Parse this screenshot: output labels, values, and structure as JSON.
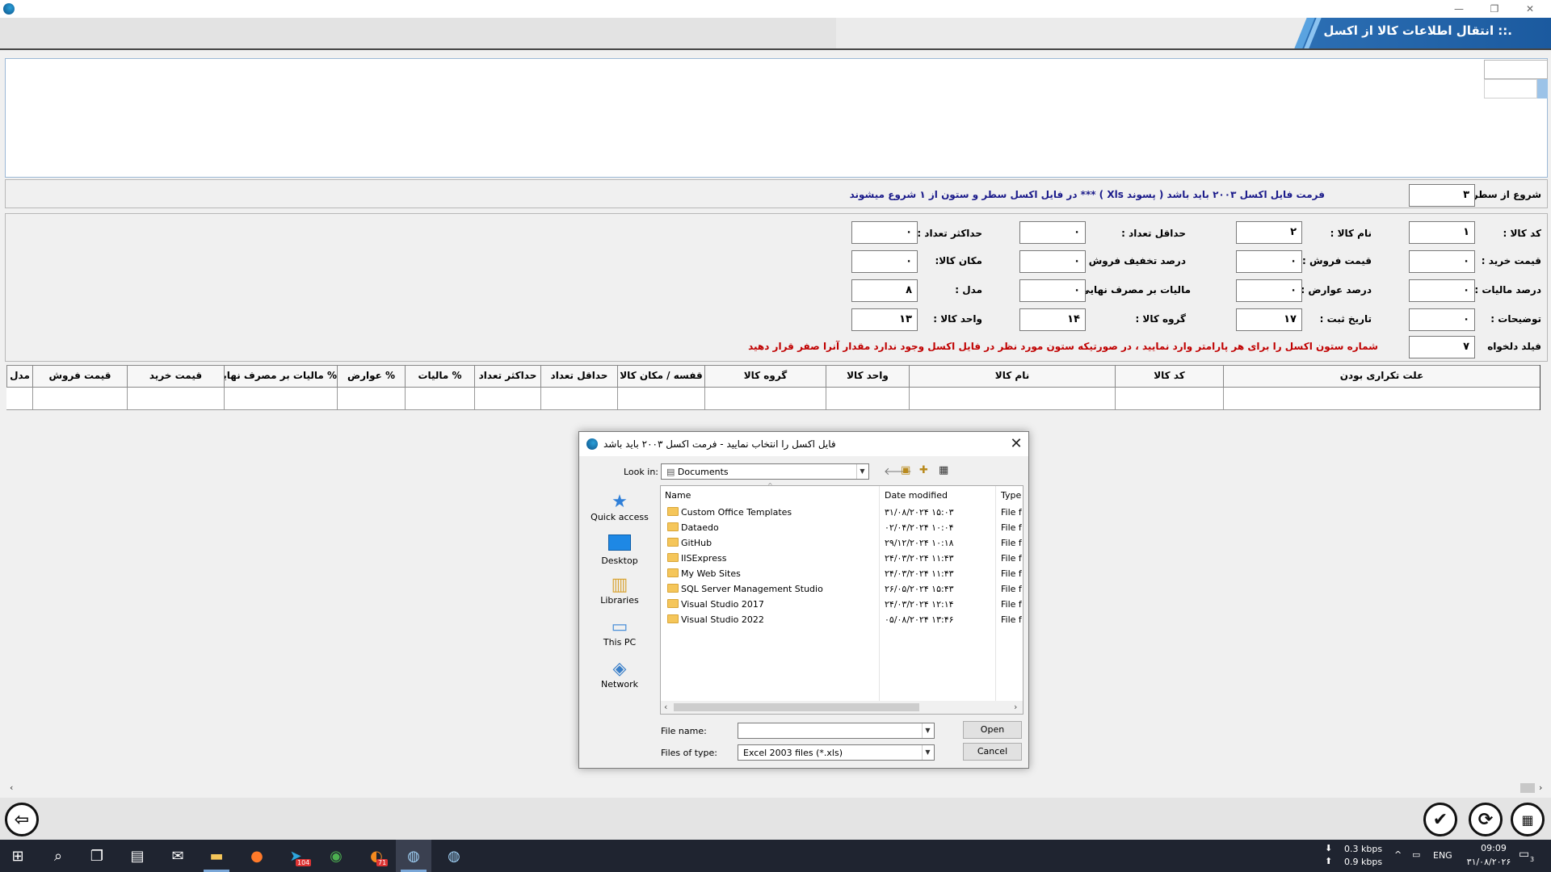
{
  "window": {
    "title": ".:: انتقال اطلاعات کالا از اکسل",
    "controls": {
      "minimize": "—",
      "restore": "❐",
      "close": "✕"
    }
  },
  "start_row": {
    "label": "شروع از سطر :",
    "value": "۳",
    "note": "فرمت فایل اکسل ۲۰۰۳ باید باشد ( پسوند Xls ) ***  در فایل اکسل سطر و ستون از ۱ شروع میشوند"
  },
  "fields": [
    {
      "key": "code",
      "label": "کد کالا :",
      "value": "۱"
    },
    {
      "key": "name",
      "label": "نام کالا :",
      "value": "۲"
    },
    {
      "key": "min_qty",
      "label": "حداقل تعداد :",
      "value": "۰"
    },
    {
      "key": "max_qty",
      "label": "حداکثر تعداد :",
      "value": "۰"
    },
    {
      "key": "buy_price",
      "label": "قیمت خرید :",
      "value": "۰"
    },
    {
      "key": "sell_price",
      "label": "قیمت فروش :",
      "value": "۰"
    },
    {
      "key": "sell_discount",
      "label": "درصد تخفیف فروش :",
      "value": "۰"
    },
    {
      "key": "location",
      "label": "مکان کالا:",
      "value": "۰"
    },
    {
      "key": "tax_percent",
      "label": "درصد مالیات :",
      "value": "۰"
    },
    {
      "key": "duty_percent",
      "label": "درصد عوارض :",
      "value": "۰"
    },
    {
      "key": "consumer_tax",
      "label": "مالیات بر مصرف نهایی :",
      "value": "۰"
    },
    {
      "key": "model",
      "label": "مدل :",
      "value": "۸"
    },
    {
      "key": "description",
      "label": "توضیحات :",
      "value": "۰"
    },
    {
      "key": "reg_date",
      "label": "تاریخ ثبت :",
      "value": "۱۷"
    },
    {
      "key": "group",
      "label": "گروه کالا :",
      "value": "۱۴"
    },
    {
      "key": "unit",
      "label": "واحد کالا :",
      "value": "۱۳"
    },
    {
      "key": "custom",
      "label": "فیلد دلخواه",
      "value": "۷"
    }
  ],
  "custom_note": "شماره ستون اکسل را برای هر پارامتر وارد نمایید ، در صورتیکه ستون  مورد نظر در فایل اکسل وجود ندارد مقدار آنرا صفر قرار دهید",
  "grid": {
    "columns": [
      "علت تکراری بودن",
      "کد کالا",
      "نام کالا",
      "واحد کالا",
      "گروه کالا",
      "قفسه / مکان کالا",
      "حداقل تعداد",
      "حداکثر تعداد",
      "% مالیات",
      "% عوارض",
      "% مالیات بر مصرف نهایی",
      "قیمت خرید",
      "قیمت فروش",
      "مدل"
    ]
  },
  "toolbar": {
    "back_icon": "arrow-left-icon",
    "confirm_icon": "checkmark-icon",
    "refresh_icon": "refresh-icon",
    "excel_icon": "excel-icon"
  },
  "dialog": {
    "title": "فایل اکسل را انتخاب نمایید - فرمت اکسل ۲۰۰۳ باید باشد",
    "look_in_label": "Look in:",
    "look_in_value": "Documents",
    "nav": [
      "Quick access",
      "Desktop",
      "Libraries",
      "This PC",
      "Network"
    ],
    "headers": {
      "name": "Name",
      "date": "Date modified",
      "type": "Type"
    },
    "files": [
      {
        "name": "Custom Office Templates",
        "date": "۳۱/۰۸/۲۰۲۴ ۱۵:۰۳",
        "type": "File fo"
      },
      {
        "name": "Dataedo",
        "date": "۰۲/۰۴/۲۰۲۴ ۱۰:۰۴",
        "type": "File fo"
      },
      {
        "name": "GitHub",
        "date": "۲۹/۱۲/۲۰۲۴ ۱۰:۱۸",
        "type": "File fo"
      },
      {
        "name": "IISExpress",
        "date": "۲۴/۰۳/۲۰۲۴ ۱۱:۴۳",
        "type": "File fo"
      },
      {
        "name": "My Web Sites",
        "date": "۲۴/۰۳/۲۰۲۴ ۱۱:۴۳",
        "type": "File fo"
      },
      {
        "name": "SQL Server Management Studio",
        "date": "۲۶/۰۵/۲۰۲۴ ۱۵:۴۳",
        "type": "File fo"
      },
      {
        "name": "Visual Studio 2017",
        "date": "۲۴/۰۳/۲۰۲۴ ۱۲:۱۴",
        "type": "File fo"
      },
      {
        "name": "Visual Studio 2022",
        "date": "۰۵/۰۸/۲۰۲۴ ۱۳:۴۶",
        "type": "File fo"
      }
    ],
    "file_name_label": "File name:",
    "file_name_value": "",
    "file_type_label": "Files of type:",
    "file_type_value": "Excel 2003 files (*.xls)",
    "open_label": "Open",
    "cancel_label": "Cancel"
  },
  "taskbar": {
    "net_down": "0.3 kbps",
    "net_up": "0.9 kbps",
    "lang": "ENG",
    "time": "09:09",
    "date": "۳۱/۰۸/۲۰۲۶",
    "telegram_badge": "104",
    "app_badge": "71",
    "notif_count": "3"
  }
}
